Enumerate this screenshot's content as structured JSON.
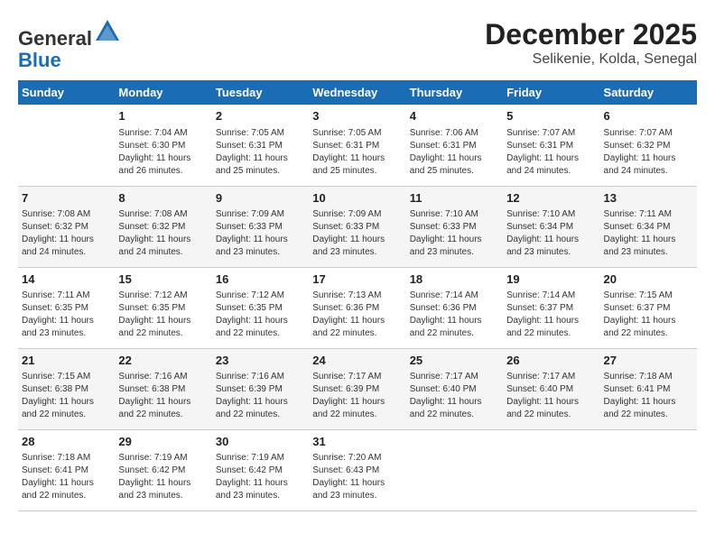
{
  "header": {
    "logo_line1": "General",
    "logo_line2": "Blue",
    "month": "December 2025",
    "location": "Selikenie, Kolda, Senegal"
  },
  "weekdays": [
    "Sunday",
    "Monday",
    "Tuesday",
    "Wednesday",
    "Thursday",
    "Friday",
    "Saturday"
  ],
  "weeks": [
    [
      {
        "day": "",
        "info": ""
      },
      {
        "day": "1",
        "info": "Sunrise: 7:04 AM\nSunset: 6:30 PM\nDaylight: 11 hours\nand 26 minutes."
      },
      {
        "day": "2",
        "info": "Sunrise: 7:05 AM\nSunset: 6:31 PM\nDaylight: 11 hours\nand 25 minutes."
      },
      {
        "day": "3",
        "info": "Sunrise: 7:05 AM\nSunset: 6:31 PM\nDaylight: 11 hours\nand 25 minutes."
      },
      {
        "day": "4",
        "info": "Sunrise: 7:06 AM\nSunset: 6:31 PM\nDaylight: 11 hours\nand 25 minutes."
      },
      {
        "day": "5",
        "info": "Sunrise: 7:07 AM\nSunset: 6:31 PM\nDaylight: 11 hours\nand 24 minutes."
      },
      {
        "day": "6",
        "info": "Sunrise: 7:07 AM\nSunset: 6:32 PM\nDaylight: 11 hours\nand 24 minutes."
      }
    ],
    [
      {
        "day": "7",
        "info": "Sunrise: 7:08 AM\nSunset: 6:32 PM\nDaylight: 11 hours\nand 24 minutes."
      },
      {
        "day": "8",
        "info": "Sunrise: 7:08 AM\nSunset: 6:32 PM\nDaylight: 11 hours\nand 24 minutes."
      },
      {
        "day": "9",
        "info": "Sunrise: 7:09 AM\nSunset: 6:33 PM\nDaylight: 11 hours\nand 23 minutes."
      },
      {
        "day": "10",
        "info": "Sunrise: 7:09 AM\nSunset: 6:33 PM\nDaylight: 11 hours\nand 23 minutes."
      },
      {
        "day": "11",
        "info": "Sunrise: 7:10 AM\nSunset: 6:33 PM\nDaylight: 11 hours\nand 23 minutes."
      },
      {
        "day": "12",
        "info": "Sunrise: 7:10 AM\nSunset: 6:34 PM\nDaylight: 11 hours\nand 23 minutes."
      },
      {
        "day": "13",
        "info": "Sunrise: 7:11 AM\nSunset: 6:34 PM\nDaylight: 11 hours\nand 23 minutes."
      }
    ],
    [
      {
        "day": "14",
        "info": "Sunrise: 7:11 AM\nSunset: 6:35 PM\nDaylight: 11 hours\nand 23 minutes."
      },
      {
        "day": "15",
        "info": "Sunrise: 7:12 AM\nSunset: 6:35 PM\nDaylight: 11 hours\nand 22 minutes."
      },
      {
        "day": "16",
        "info": "Sunrise: 7:12 AM\nSunset: 6:35 PM\nDaylight: 11 hours\nand 22 minutes."
      },
      {
        "day": "17",
        "info": "Sunrise: 7:13 AM\nSunset: 6:36 PM\nDaylight: 11 hours\nand 22 minutes."
      },
      {
        "day": "18",
        "info": "Sunrise: 7:14 AM\nSunset: 6:36 PM\nDaylight: 11 hours\nand 22 minutes."
      },
      {
        "day": "19",
        "info": "Sunrise: 7:14 AM\nSunset: 6:37 PM\nDaylight: 11 hours\nand 22 minutes."
      },
      {
        "day": "20",
        "info": "Sunrise: 7:15 AM\nSunset: 6:37 PM\nDaylight: 11 hours\nand 22 minutes."
      }
    ],
    [
      {
        "day": "21",
        "info": "Sunrise: 7:15 AM\nSunset: 6:38 PM\nDaylight: 11 hours\nand 22 minutes."
      },
      {
        "day": "22",
        "info": "Sunrise: 7:16 AM\nSunset: 6:38 PM\nDaylight: 11 hours\nand 22 minutes."
      },
      {
        "day": "23",
        "info": "Sunrise: 7:16 AM\nSunset: 6:39 PM\nDaylight: 11 hours\nand 22 minutes."
      },
      {
        "day": "24",
        "info": "Sunrise: 7:17 AM\nSunset: 6:39 PM\nDaylight: 11 hours\nand 22 minutes."
      },
      {
        "day": "25",
        "info": "Sunrise: 7:17 AM\nSunset: 6:40 PM\nDaylight: 11 hours\nand 22 minutes."
      },
      {
        "day": "26",
        "info": "Sunrise: 7:17 AM\nSunset: 6:40 PM\nDaylight: 11 hours\nand 22 minutes."
      },
      {
        "day": "27",
        "info": "Sunrise: 7:18 AM\nSunset: 6:41 PM\nDaylight: 11 hours\nand 22 minutes."
      }
    ],
    [
      {
        "day": "28",
        "info": "Sunrise: 7:18 AM\nSunset: 6:41 PM\nDaylight: 11 hours\nand 22 minutes."
      },
      {
        "day": "29",
        "info": "Sunrise: 7:19 AM\nSunset: 6:42 PM\nDaylight: 11 hours\nand 23 minutes."
      },
      {
        "day": "30",
        "info": "Sunrise: 7:19 AM\nSunset: 6:42 PM\nDaylight: 11 hours\nand 23 minutes."
      },
      {
        "day": "31",
        "info": "Sunrise: 7:20 AM\nSunset: 6:43 PM\nDaylight: 11 hours\nand 23 minutes."
      },
      {
        "day": "",
        "info": ""
      },
      {
        "day": "",
        "info": ""
      },
      {
        "day": "",
        "info": ""
      }
    ]
  ]
}
